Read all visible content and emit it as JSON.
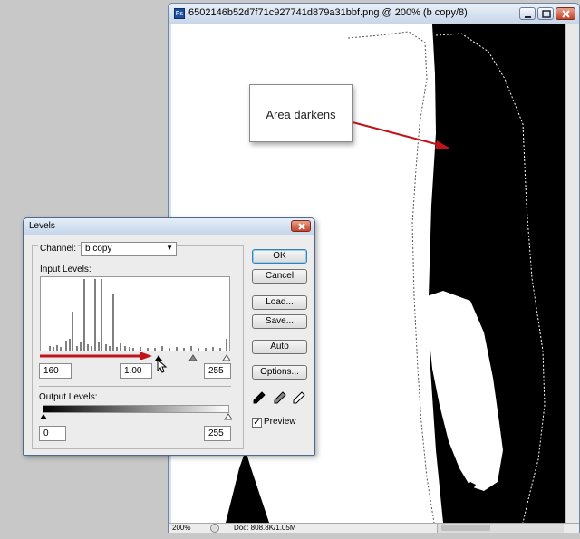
{
  "document": {
    "title": "6502146b52d7f71c927741d879a31bbf.png @ 200% (b copy/8)",
    "app_badge": "Ps",
    "zoom": "200%",
    "doc_info": "Doc: 808.8K/1.05M"
  },
  "callout": {
    "text": "Area darkens"
  },
  "levels": {
    "title": "Levels",
    "channel_label": "Channel:",
    "channel_value": "b copy",
    "input_levels_label": "Input Levels:",
    "input_black": "160",
    "input_gamma": "1.00",
    "input_white": "255",
    "output_levels_label": "Output Levels:",
    "output_black": "0",
    "output_white": "255",
    "buttons": {
      "ok": "OK",
      "cancel": "Cancel",
      "load": "Load...",
      "save": "Save...",
      "auto": "Auto",
      "options": "Options..."
    },
    "preview_label": "Preview",
    "preview_checked": true
  },
  "colors": {
    "annotation_arrow": "#c0141c",
    "image_dark": "#000000",
    "image_light": "#ffffff"
  }
}
